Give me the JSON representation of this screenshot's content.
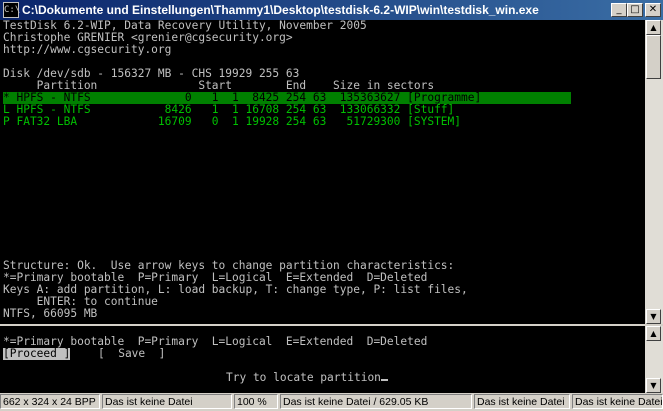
{
  "titlebar": {
    "title": "C:\\Dokumente und Einstellungen\\Thammy1\\Desktop\\testdisk-6.2-WIP\\win\\testdisk_win.exe",
    "icon_name": "console-window-icon"
  },
  "console": {
    "header1": "TestDisk 6.2-WIP, Data Recovery Utility, November 2005",
    "header2": "Christophe GRENIER <grenier@cgsecurity.org>",
    "header3": "http://www.cgsecurity.org",
    "disk_line": "Disk /dev/sdb - 156327 MB - CHS 19929 255 63",
    "col_header": "     Partition               Start        End    Size in sectors",
    "partitions": [
      {
        "text": "* HPFS - NTFS              0   1  1  8425 254 63  135363627 [Programme]",
        "selected": true
      },
      {
        "text": "L HPFS - NTFS           8426   1  1 16708 254 63  133066332 [Stuff]",
        "selected": false
      },
      {
        "text": "P FAT32 LBA            16709   0  1 19928 254 63   51729300 [SYSTEM]",
        "selected": false
      }
    ],
    "structure_line": "Structure: Ok.  Use arrow keys to change partition characteristics:",
    "legend_line": "*=Primary bootable  P=Primary  L=Logical  E=Extended  D=Deleted",
    "keys_line1": "Keys A: add partition, L: load backup, T: change type, P: list files,",
    "keys_line2": "     ENTER: to continue",
    "fs_line": "NTFS, 66095 MB"
  },
  "lower_console": {
    "legend_line": "*=Primary bootable  P=Primary  L=Logical  E=Extended  D=Deleted",
    "proceed_label": "[Proceed ]",
    "save_label": "[  Save  ]",
    "status": "Try to locate partition"
  },
  "statusbar": {
    "dims": "662 x 324 x 24 BPP",
    "file1": "Das ist keine Datei",
    "zoom": "100 %",
    "file2": "Das ist keine Datei / 629.05 KB",
    "file3": "Das ist keine Datei",
    "file4": "Das ist keine Datei"
  },
  "colors": {
    "title_bg": "#0a246a",
    "console_bg": "#000000",
    "console_fg": "#c0c0c0",
    "partition_fg": "#00c000",
    "selection_bg": "#008000"
  }
}
